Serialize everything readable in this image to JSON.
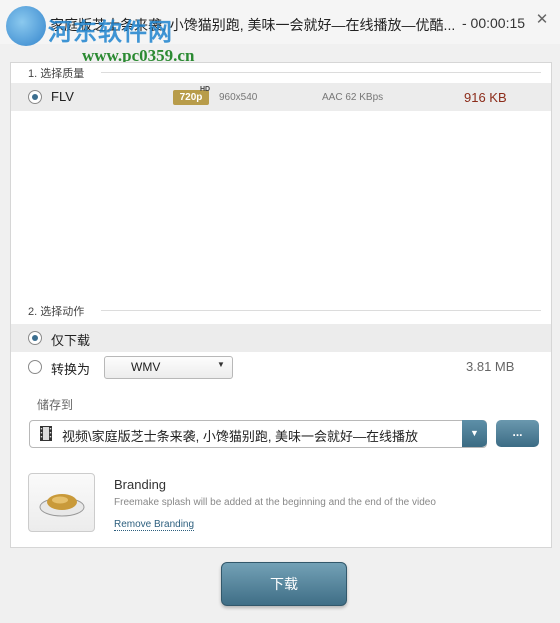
{
  "window": {
    "title": "家庭版芝士条来袭, 小馋猫别跑, 美味一会就好—在线播放—优酷...",
    "duration": "- 00:00:15",
    "close_symbol": "✕"
  },
  "watermark": {
    "brand": "河东软件网",
    "url": "www.pc0359.cn"
  },
  "quality": {
    "section_label": "1. 选择质量",
    "option": {
      "format": "FLV",
      "badge": "720p",
      "badge_hd": "HD",
      "resolution": "960x540",
      "audio": "AAC 62  KBps",
      "size": "916 KB"
    }
  },
  "action": {
    "section_label": "2. 选择动作",
    "download_only": "仅下载",
    "convert_to": "转换为",
    "convert_format": "WMV",
    "convert_size": "3.81 MB"
  },
  "save": {
    "label": "储存到",
    "path": "视频\\家庭版芝士条来袭, 小馋猫别跑, 美味一会就好—在线播放",
    "browse_label": "..."
  },
  "branding": {
    "title": "Branding",
    "description": "Freemake splash will be added at the beginning and the end of the video",
    "remove_link": "Remove Branding"
  },
  "primary_action": {
    "label": "下载"
  }
}
